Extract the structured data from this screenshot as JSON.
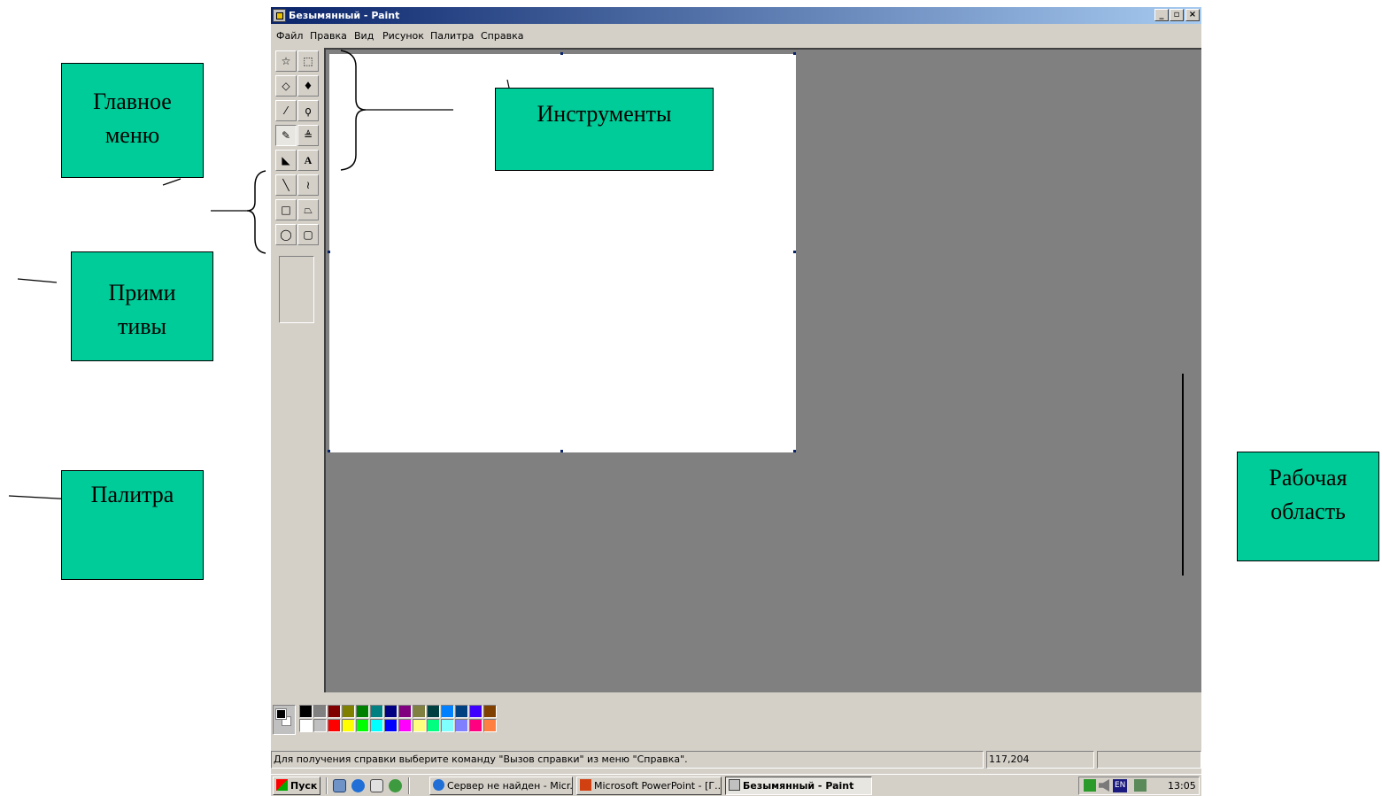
{
  "window": {
    "title": "Безымянный - Paint",
    "controls": {
      "minimize": "_",
      "maximize": "a",
      "close": "×"
    }
  },
  "menu": [
    "Файл",
    "Правка",
    "Вид",
    "Рисунок",
    "Палитра",
    "Справка"
  ],
  "tools": [
    {
      "name": "free-select-tool",
      "glyph": "☆"
    },
    {
      "name": "rect-select-tool",
      "glyph": "⬚"
    },
    {
      "name": "eraser-tool",
      "glyph": "◇"
    },
    {
      "name": "fill-tool",
      "glyph": "♦"
    },
    {
      "name": "color-picker-tool",
      "glyph": "⁄"
    },
    {
      "name": "magnifier-tool",
      "glyph": "ϙ"
    },
    {
      "name": "pencil-tool",
      "glyph": "✎"
    },
    {
      "name": "brush-tool",
      "glyph": "≜"
    },
    {
      "name": "airbrush-tool",
      "glyph": "◣"
    },
    {
      "name": "text-tool",
      "glyph": "A"
    },
    {
      "name": "line-tool",
      "glyph": "╲"
    },
    {
      "name": "curve-tool",
      "glyph": "≀"
    },
    {
      "name": "rectangle-tool",
      "glyph": "□"
    },
    {
      "name": "polygon-tool",
      "glyph": "⏢"
    },
    {
      "name": "ellipse-tool",
      "glyph": "◯"
    },
    {
      "name": "rounded-rect-tool",
      "glyph": "▢"
    }
  ],
  "palette": {
    "foreground": "#000000",
    "background": "#ffffff",
    "row1": [
      "#000000",
      "#808080",
      "#800000",
      "#808000",
      "#008000",
      "#008080",
      "#000080",
      "#800080",
      "#808040",
      "#004040",
      "#0080ff",
      "#004080",
      "#4000ff",
      "#804000"
    ],
    "row2": [
      "#ffffff",
      "#c0c0c0",
      "#ff0000",
      "#ffff00",
      "#00ff00",
      "#00ffff",
      "#0000ff",
      "#ff00ff",
      "#ffff80",
      "#00ff80",
      "#80ffff",
      "#8080ff",
      "#ff0080",
      "#ff8040"
    ]
  },
  "status": {
    "help": "Для получения справки выберите команду \"Вызов справки\" из меню \"Справка\".",
    "coords": "117,204"
  },
  "taskbar": {
    "start": "Пуск",
    "items": [
      {
        "label": "Сервер не найден - Micr...",
        "active": false
      },
      {
        "label": "Microsoft PowerPoint - [Г...",
        "active": false
      },
      {
        "label": "Безымянный - Paint",
        "active": true
      }
    ],
    "lang": "EN",
    "clock": "13:05"
  },
  "annotations": {
    "main_menu": [
      "Главное",
      "меню"
    ],
    "tools": [
      "Инструменты"
    ],
    "primitives": [
      "Прими",
      "тивы"
    ],
    "palette": [
      "Палитра"
    ],
    "workspace": [
      "Рабочая",
      "область"
    ]
  }
}
